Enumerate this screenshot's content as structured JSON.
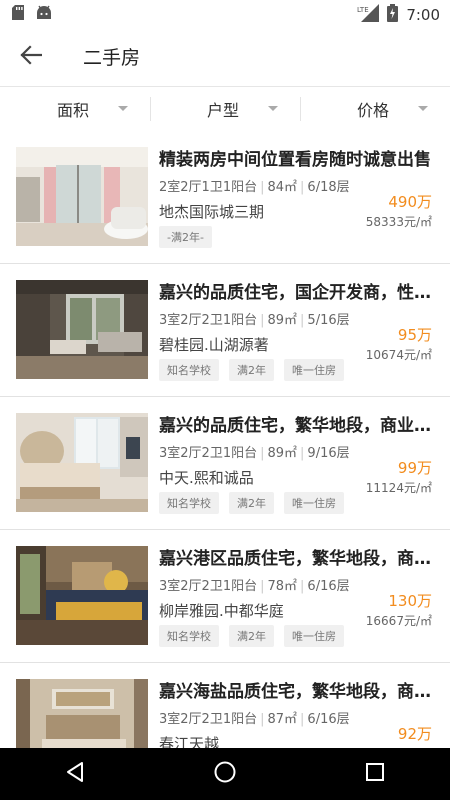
{
  "status_bar": {
    "time": "7:00",
    "icons": [
      "sd-card-icon",
      "android-icon",
      "lte-signal-icon",
      "battery-charging-icon"
    ],
    "lte_label": "LTE"
  },
  "app_bar": {
    "title": "二手房",
    "back_icon": "arrow-left-icon"
  },
  "filters": [
    {
      "label": "面积"
    },
    {
      "label": "户型"
    },
    {
      "label": "价格"
    }
  ],
  "listings": [
    {
      "title": "精装两房中间位置看房随时诚意出售",
      "layout": "2室2厅1卫1阳台",
      "area": "84㎡",
      "floor": "6/18层",
      "community": "地杰国际城三期",
      "tags": [
        "-满2年-"
      ],
      "price": "490万",
      "unit_price": "58333元/㎡"
    },
    {
      "title": "嘉兴的品质住宅，国企开发商，性价比高",
      "layout": "3室2厅2卫1阳台",
      "area": "89㎡",
      "floor": "5/16层",
      "community": "碧桂园.山湖源著",
      "tags": [
        "知名学校",
        "满2年",
        "唯一住房"
      ],
      "price": "95万",
      "unit_price": "10674元/㎡"
    },
    {
      "title": "嘉兴的品质住宅，繁华地段，商业配套",
      "layout": "3室2厅2卫1阳台",
      "area": "89㎡",
      "floor": "9/16层",
      "community": "中天.熙和诚品",
      "tags": [
        "知名学校",
        "满2年",
        "唯一住房"
      ],
      "price": "99万",
      "unit_price": "11124元/㎡"
    },
    {
      "title": "嘉兴港区品质住宅，繁华地段，商业配套",
      "layout": "3室2厅2卫1阳台",
      "area": "78㎡",
      "floor": "6/16层",
      "community": "柳岸雅园.中都华庭",
      "tags": [
        "知名学校",
        "满2年",
        "唯一住房"
      ],
      "price": "130万",
      "unit_price": "16667元/㎡"
    },
    {
      "title": "嘉兴海盐品质住宅，繁华地段，商业配套",
      "layout": "3室2厅2卫1阳台",
      "area": "87㎡",
      "floor": "6/16层",
      "community": "春江天越",
      "tags": [],
      "price": "92万",
      "unit_price": ""
    }
  ],
  "nav_bar": {
    "icons": [
      "back-triangle-icon",
      "home-circle-icon",
      "recents-square-icon"
    ]
  },
  "colors": {
    "price": "#f28c1e",
    "nav_background": "#000000"
  }
}
